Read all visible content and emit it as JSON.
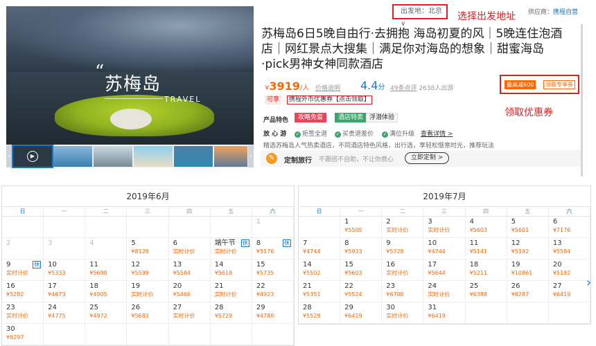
{
  "hero": {
    "city": "苏梅岛",
    "quote_mark": "“",
    "travel": "TRAVEL"
  },
  "thumbs": [
    "video",
    "pool",
    "villa",
    "beach",
    "island",
    "sunset"
  ],
  "header": {
    "depart_label": "出发地：北京",
    "depart_annotation": "选择出发地址",
    "supplier_label": "供应商：",
    "supplier_name": "携程自营"
  },
  "product": {
    "title": "苏梅岛6日5晚自由行·去拥抱 海岛初夏的风｜5晚连住泡酒店｜网红景点大搜集｜满足你对海岛的想象｜甜蜜海岛·pick男神女神同款酒店",
    "currency": "¥",
    "price": "3919",
    "price_unit": "/人",
    "price_note": "价格说明",
    "score": "4.4",
    "score_unit": "分",
    "review_count": "49条点评",
    "travelers": "2638人出游",
    "coupon_tag": "最高减600",
    "coupon_link": "领取专享券",
    "coupon_annotation": "领取优惠券",
    "exchange_tag": "可享",
    "exchange_text": "携程外币优惠券【点击领取】",
    "features_label": "产品特色",
    "features": [
      "攻略免套",
      "酒店特卖",
      "浮潜体验"
    ],
    "assure_label": "放 心 游",
    "assurances": [
      "拒签全退",
      "买贵退差价",
      "满位升级"
    ],
    "details_link": "查看详情 >",
    "cut_row": "精选苏梅岛人气热卖酒店，不同酒店特色风格，出行选，享轻松惬意时光，推荐玩法",
    "custom_label": "定制旅行",
    "custom_desc": "不跟团不自助，不让你费心",
    "custom_button": "立即定制 >"
  },
  "weekdays": [
    "日",
    "一",
    "二",
    "三",
    "四",
    "五",
    "六"
  ],
  "calendar": {
    "june": {
      "title": "2019年6月",
      "cells": [
        {
          "d": "",
          "p": ""
        },
        {
          "d": "",
          "p": ""
        },
        {
          "d": "",
          "p": ""
        },
        {
          "d": "",
          "p": ""
        },
        {
          "d": "",
          "p": ""
        },
        {
          "d": "",
          "p": ""
        },
        {
          "d": "1",
          "p": "",
          "dim": true
        },
        {
          "d": "2",
          "p": "",
          "dim": true
        },
        {
          "d": "3",
          "p": "",
          "dim": true
        },
        {
          "d": "4",
          "p": "",
          "dim": true
        },
        {
          "d": "5",
          "p": "¥8128"
        },
        {
          "d": "6",
          "p": "实时计价"
        },
        {
          "d": "端午节",
          "p": "实时计价",
          "rest": "休"
        },
        {
          "d": "8",
          "p": "¥5176",
          "rest": "休"
        },
        {
          "d": "9",
          "p": "实时计价",
          "rest": "休"
        },
        {
          "d": "10",
          "p": "¥5333"
        },
        {
          "d": "11",
          "p": "¥5698"
        },
        {
          "d": "12",
          "p": "¥5599"
        },
        {
          "d": "13",
          "p": "¥5584"
        },
        {
          "d": "14",
          "p": "¥5618"
        },
        {
          "d": "15",
          "p": "¥5735"
        },
        {
          "d": "16",
          "p": "¥5282"
        },
        {
          "d": "17",
          "p": "¥4673"
        },
        {
          "d": "18",
          "p": "¥4905"
        },
        {
          "d": "19",
          "p": "实时计价"
        },
        {
          "d": "20",
          "p": "¥5466"
        },
        {
          "d": "21",
          "p": "实时计价"
        },
        {
          "d": "22",
          "p": "¥4923"
        },
        {
          "d": "23",
          "p": "实时计价"
        },
        {
          "d": "24",
          "p": "¥4775"
        },
        {
          "d": "25",
          "p": "¥4972"
        },
        {
          "d": "26",
          "p": "¥5683"
        },
        {
          "d": "27",
          "p": "实时计价"
        },
        {
          "d": "28",
          "p": "¥5729"
        },
        {
          "d": "29",
          "p": "¥4788"
        },
        {
          "d": "30",
          "p": "¥6297"
        },
        {
          "d": "",
          "p": ""
        },
        {
          "d": "",
          "p": ""
        },
        {
          "d": "",
          "p": ""
        },
        {
          "d": "",
          "p": ""
        },
        {
          "d": "",
          "p": ""
        },
        {
          "d": "",
          "p": ""
        }
      ]
    },
    "july": {
      "title": "2019年7月",
      "cells": [
        {
          "d": "",
          "p": ""
        },
        {
          "d": "1",
          "p": "¥5505"
        },
        {
          "d": "2",
          "p": "实时计价"
        },
        {
          "d": "3",
          "p": "实时计价"
        },
        {
          "d": "4",
          "p": "¥5603"
        },
        {
          "d": "5",
          "p": "¥5601"
        },
        {
          "d": "6",
          "p": "¥7176"
        },
        {
          "d": "7",
          "p": "¥4744"
        },
        {
          "d": "8",
          "p": "¥5933"
        },
        {
          "d": "9",
          "p": "¥5728"
        },
        {
          "d": "10",
          "p": "¥4744"
        },
        {
          "d": "11",
          "p": "¥5141"
        },
        {
          "d": "12",
          "p": "¥5192"
        },
        {
          "d": "13",
          "p": "¥5584"
        },
        {
          "d": "14",
          "p": "¥5502"
        },
        {
          "d": "15",
          "p": "¥5603"
        },
        {
          "d": "16",
          "p": "实时计价"
        },
        {
          "d": "17",
          "p": "¥5644"
        },
        {
          "d": "18",
          "p": "¥5211"
        },
        {
          "d": "19",
          "p": "¥10861"
        },
        {
          "d": "20",
          "p": "¥5192"
        },
        {
          "d": "21",
          "p": "¥5351"
        },
        {
          "d": "22",
          "p": "¥5524"
        },
        {
          "d": "23",
          "p": "¥6700"
        },
        {
          "d": "24",
          "p": "实时计价"
        },
        {
          "d": "25",
          "p": "¥6388"
        },
        {
          "d": "26",
          "p": "¥6287"
        },
        {
          "d": "27",
          "p": "¥6419"
        },
        {
          "d": "28",
          "p": "¥5529"
        },
        {
          "d": "29",
          "p": "¥6419"
        },
        {
          "d": "30",
          "p": "实时计价"
        },
        {
          "d": "31",
          "p": "¥6419"
        },
        {
          "d": "",
          "p": ""
        },
        {
          "d": "",
          "p": ""
        },
        {
          "d": "",
          "p": ""
        }
      ]
    }
  },
  "colors": {
    "accent": "#1677d2",
    "price": "#ff6600",
    "annotation": "#e02020"
  }
}
